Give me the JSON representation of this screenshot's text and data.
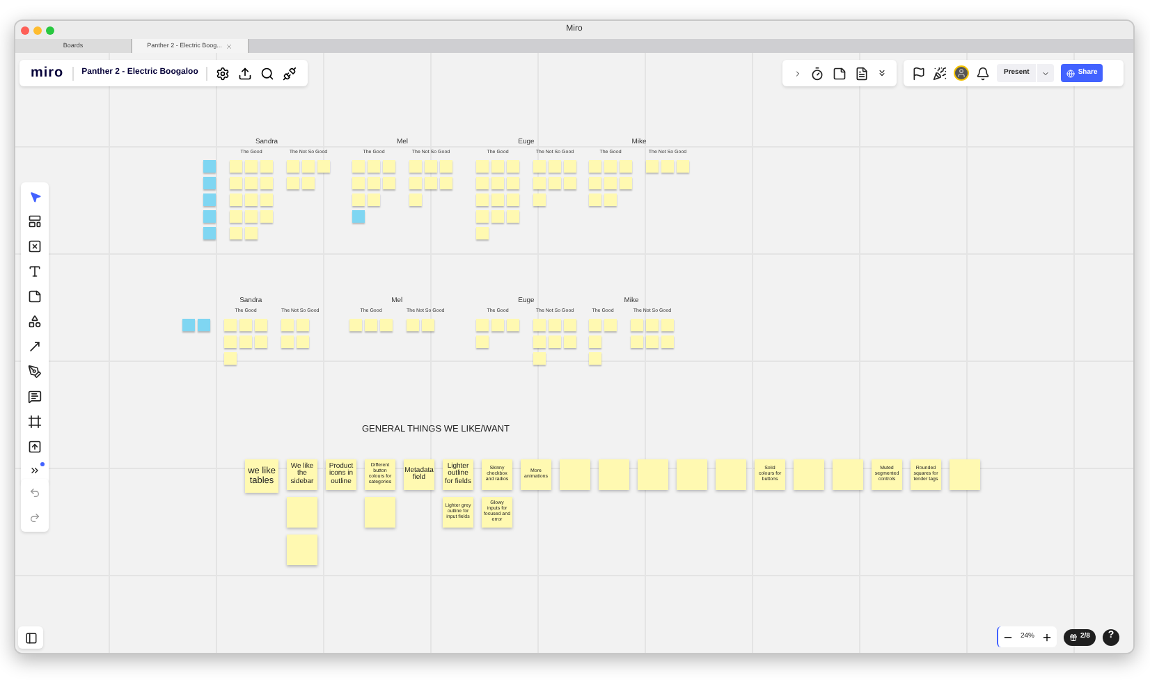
{
  "window": {
    "title": "Miro"
  },
  "tabs": [
    {
      "label": "Boards",
      "selected": false
    },
    {
      "label": "Panther 2 - Electric Boog...",
      "selected": true
    }
  ],
  "board_bar": {
    "logo": "miro",
    "board_title": "Panther 2 - Electric Boogaloo"
  },
  "actions": {
    "present": "Present",
    "share": "Share"
  },
  "zoom": {
    "reading": "24%"
  },
  "pages": "2/8",
  "help": "?",
  "feedback_rows": [
    {
      "sections": [
        {
          "person": "Sandra",
          "groups": [
            {
              "rows": [
                [
                  {
                    "color": "#7fd6f2"
                  }
                ],
                [
                  {
                    "color": "#7fd6f2"
                  }
                ],
                [
                  {
                    "color": "#7fd6f2"
                  }
                ],
                [
                  {
                    "color": "#7fd6f2"
                  }
                ],
                [
                  {
                    "color": "#7fd6f2"
                  }
                ]
              ]
            },
            {
              "title": "The Good",
              "rows": [
                [
                  {
                    "color": "#fff9b1"
                  },
                  {
                    "color": "#fff9b1"
                  },
                  {
                    "color": "#fff9b1"
                  }
                ],
                [
                  {
                    "color": "#fff9b1"
                  },
                  {
                    "color": "#fff9b1"
                  },
                  {
                    "color": "#fff9b1"
                  }
                ],
                [
                  {
                    "color": "#fff9b1"
                  },
                  {
                    "color": "#fff9b1"
                  },
                  {
                    "color": "#fff9b1"
                  }
                ],
                [
                  {
                    "color": "#fff9b1"
                  },
                  {
                    "color": "#fff9b1"
                  },
                  {
                    "color": "#fff9b1"
                  }
                ],
                [
                  {
                    "color": "#fff9b1"
                  },
                  {
                    "color": "#fff9b1"
                  }
                ]
              ]
            },
            {
              "title": "The Not So Good",
              "rows": [
                [
                  {
                    "color": "#fff9b1"
                  },
                  {
                    "color": "#fff9b1"
                  },
                  {
                    "color": "#fff9b1"
                  }
                ],
                [
                  {
                    "color": "#fff9b1"
                  },
                  {
                    "color": "#fff9b1"
                  }
                ]
              ]
            }
          ]
        },
        {
          "person": "Mel",
          "groups": [
            {
              "title": "The Good",
              "rows": [
                [
                  {
                    "color": "#fff9b1"
                  },
                  {
                    "color": "#fff9b1"
                  },
                  {
                    "color": "#fff9b1"
                  }
                ],
                [
                  {
                    "color": "#fff9b1"
                  },
                  {
                    "color": "#fff9b1"
                  },
                  {
                    "color": "#fff9b1"
                  }
                ],
                [
                  {
                    "color": "#fff9b1"
                  },
                  {
                    "color": "#fff9b1"
                  }
                ],
                [
                  {
                    "color": "#7fd6f2"
                  }
                ]
              ]
            },
            {
              "title": "The Not So Good",
              "rows": [
                [
                  {
                    "color": "#fff9b1"
                  },
                  {
                    "color": "#fff9b1"
                  },
                  {
                    "color": "#fff9b1"
                  }
                ],
                [
                  {
                    "color": "#fff9b1"
                  },
                  {
                    "color": "#fff9b1"
                  },
                  {
                    "color": "#fff9b1"
                  }
                ],
                [
                  {
                    "color": "#fff9b1"
                  }
                ]
              ]
            }
          ]
        },
        {
          "person": "Euge",
          "groups": [
            {
              "title": "The Good",
              "rows": [
                [
                  {
                    "color": "#fff9b1"
                  },
                  {
                    "color": "#fff9b1"
                  },
                  {
                    "color": "#fff9b1"
                  }
                ],
                [
                  {
                    "color": "#fff9b1"
                  },
                  {
                    "color": "#fff9b1"
                  },
                  {
                    "color": "#fff9b1"
                  }
                ],
                [
                  {
                    "color": "#fff9b1"
                  },
                  {
                    "color": "#fff9b1"
                  },
                  {
                    "color": "#fff9b1"
                  }
                ],
                [
                  {
                    "color": "#fff9b1"
                  },
                  {
                    "color": "#fff9b1"
                  },
                  {
                    "color": "#fff9b1"
                  }
                ],
                [
                  {
                    "color": "#fff9b1"
                  }
                ]
              ]
            },
            {
              "title": "The Not So Good",
              "rows": [
                [
                  {
                    "color": "#fff9b1"
                  },
                  {
                    "color": "#fff9b1"
                  },
                  {
                    "color": "#fff9b1"
                  }
                ],
                [
                  {
                    "color": "#fff9b1"
                  },
                  {
                    "color": "#fff9b1"
                  },
                  {
                    "color": "#fff9b1"
                  }
                ],
                [
                  {
                    "color": "#fff9b1"
                  }
                ]
              ]
            }
          ]
        },
        {
          "person": "Mike",
          "groups": [
            {
              "title": "The Good",
              "rows": [
                [
                  {
                    "color": "#fff9b1"
                  },
                  {
                    "color": "#fff9b1"
                  },
                  {
                    "color": "#fff9b1"
                  }
                ],
                [
                  {
                    "color": "#fff9b1"
                  },
                  {
                    "color": "#fff9b1"
                  },
                  {
                    "color": "#fff9b1"
                  }
                ],
                [
                  {
                    "color": "#fff9b1"
                  },
                  {
                    "color": "#fff9b1"
                  }
                ]
              ]
            },
            {
              "title": "The Not So Good",
              "rows": [
                [
                  {
                    "color": "#fff9b1"
                  },
                  {
                    "color": "#fff9b1"
                  },
                  {
                    "color": "#fff9b1"
                  }
                ]
              ]
            }
          ]
        }
      ]
    },
    {
      "sections": [
        {
          "person": "Sandra",
          "groups": [
            {
              "rows": [
                [
                  {
                    "color": "#7fd6f2"
                  },
                  {
                    "color": "#7fd6f2"
                  }
                ]
              ]
            },
            {
              "title": "The Good",
              "rows": [
                [
                  {
                    "color": "#fff9b1"
                  },
                  {
                    "color": "#fff9b1"
                  },
                  {
                    "color": "#fff9b1"
                  }
                ],
                [
                  {
                    "color": "#fff9b1"
                  },
                  {
                    "color": "#fff9b1"
                  },
                  {
                    "color": "#fff9b1"
                  }
                ],
                [
                  {
                    "color": "#fff9b1"
                  }
                ]
              ]
            },
            {
              "title": "The Not So Good",
              "rows": [
                [
                  {
                    "color": "#fff9b1"
                  },
                  {
                    "color": "#fff9b1"
                  }
                ],
                [
                  {
                    "color": "#fff9b1"
                  },
                  {
                    "color": "#fff9b1"
                  }
                ]
              ]
            }
          ]
        },
        {
          "person": "Mel",
          "groups": [
            {
              "title": "The Good",
              "rows": [
                [
                  {
                    "color": "#fff9b1"
                  },
                  {
                    "color": "#fff9b1"
                  },
                  {
                    "color": "#fff9b1"
                  }
                ]
              ]
            },
            {
              "title": "The Not So Good",
              "rows": [
                [
                  {
                    "color": "#fff9b1"
                  },
                  {
                    "color": "#fff9b1"
                  }
                ]
              ]
            }
          ]
        },
        {
          "person": "Euge",
          "groups": [
            {
              "title": "The Good",
              "rows": [
                [
                  {
                    "color": "#fff9b1"
                  },
                  {
                    "color": "#fff9b1"
                  },
                  {
                    "color": "#fff9b1"
                  }
                ],
                [
                  {
                    "color": "#fff9b1"
                  }
                ]
              ]
            },
            {
              "title": "The Not So Good",
              "rows": [
                [
                  {
                    "color": "#fff9b1"
                  },
                  {
                    "color": "#fff9b1"
                  },
                  {
                    "color": "#fff9b1"
                  }
                ],
                [
                  {
                    "color": "#fff9b1"
                  },
                  {
                    "color": "#fff9b1"
                  },
                  {
                    "color": "#fff9b1"
                  }
                ],
                [
                  {
                    "color": "#fff9b1"
                  }
                ]
              ]
            }
          ]
        },
        {
          "person": "Mike",
          "groups": [
            {
              "title": "The Good",
              "rows": [
                [
                  {
                    "color": "#fff9b1"
                  },
                  {
                    "color": "#fff9b1"
                  }
                ],
                [
                  {
                    "color": "#fff9b1"
                  }
                ],
                [
                  {
                    "color": "#fff9b1"
                  }
                ]
              ]
            },
            {
              "title": "The Not So Good",
              "rows": [
                [
                  {
                    "color": "#fff9b1"
                  },
                  {
                    "color": "#fff9b1"
                  },
                  {
                    "color": "#fff9b1"
                  }
                ],
                [
                  {
                    "color": "#fff9b1"
                  },
                  {
                    "color": "#fff9b1"
                  },
                  {
                    "color": "#fff9b1"
                  }
                ]
              ]
            }
          ]
        }
      ]
    }
  ],
  "general": {
    "title": "GENERAL THINGS WE LIKE/WANT",
    "columns": [
      [
        {
          "text": "we like tables",
          "kind": "large"
        }
      ],
      [
        {
          "text": "We like the sidebar",
          "kind": "medium"
        },
        {
          "kind": "small"
        },
        {
          "kind": "small"
        }
      ],
      [
        {
          "text": "Product icons in outline",
          "kind": "medium"
        }
      ],
      [
        {
          "text": "Different button colours for categories",
          "kind": "small"
        },
        {
          "kind": "small"
        }
      ],
      [
        {
          "text": "Metadata field",
          "kind": "medium"
        }
      ],
      [
        {
          "text": "Lighter outline for fields",
          "kind": "medium"
        },
        {
          "text": "Lighter grey outline for input fields",
          "kind": "small"
        }
      ],
      [
        {
          "text": "Skinny checkbox and radios",
          "kind": "small"
        },
        {
          "text": "Glowy inputs for focused and error",
          "kind": "small"
        }
      ],
      [
        {
          "text": "More animations",
          "kind": "small"
        }
      ],
      [
        {
          "kind": "small"
        }
      ],
      [
        {
          "kind": "small"
        }
      ],
      [
        {
          "kind": "small"
        }
      ],
      [
        {
          "kind": "small"
        }
      ],
      [
        {
          "kind": "small"
        }
      ],
      [
        {
          "text": "Solid colours for buttons",
          "kind": "small"
        }
      ],
      [
        {
          "kind": "small"
        }
      ],
      [
        {
          "kind": "small"
        }
      ],
      [
        {
          "text": "Muted segmented controls",
          "kind": "small"
        }
      ],
      [
        {
          "text": "Rounded squares for tender tags",
          "kind": "small"
        }
      ],
      [
        {
          "kind": "small"
        }
      ]
    ]
  }
}
